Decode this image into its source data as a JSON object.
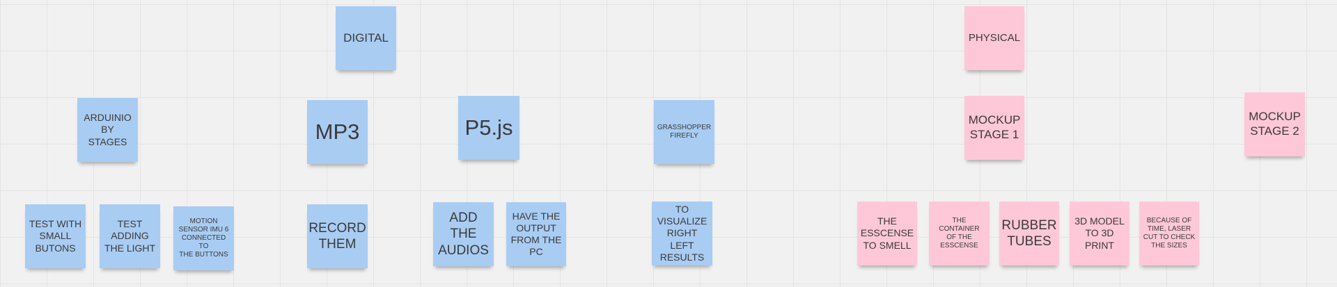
{
  "board": {
    "notes": {
      "digital": "DIGITAL",
      "physical": "PHYSICAL",
      "arduino_stages": "ARDUINIO\nBY\nSTAGES",
      "mp3": "MP3",
      "p5js": "P5.js",
      "grasshopper_firefly": "GRASSHOPPER\nFIREFLY",
      "mockup_stage_1": "MOCKUP\nSTAGE 1",
      "mockup_stage_2": "MOCKUP\nSTAGE 2",
      "test_small_buttons": "TEST WITH\nSMALL\nBUTONS",
      "test_adding_light": "TEST\nADDING\nTHE LIGHT",
      "motion_sensor": "MOTION\nSENSOR IMU 6\nCONNECTED TO\nTHE BUTTONS",
      "record_them": "RECORD\nTHEM",
      "add_audios": "ADD\nTHE\nAUDIOS",
      "output_from_pc": "HAVE THE\nOUTPUT\nFROM THE\nPC",
      "visualize_results": "TO\nVISUALIZE\nRIGHT LEFT\nRESULTS",
      "essence_to_smell": "THE\nESSCENSE\nTO SMELL",
      "container_essence": "THE\nCONTAINER\nOF THE\nESSCENSE",
      "rubber_tubes": "RUBBER\nTUBES",
      "model_3d_print": "3D MODEL\nTO 3D\nPRINT",
      "laser_cut_sizes": "BECAUSE OF\nTIME, LASER\nCUT TO CHECK\nTHE SIZES"
    }
  },
  "colors": {
    "canvas": "#f1f1f1",
    "grid": "#e4e4e4",
    "note_blue": "#a9ccf3",
    "note_pink": "#fec8d8",
    "text": "#3a3a3a"
  }
}
